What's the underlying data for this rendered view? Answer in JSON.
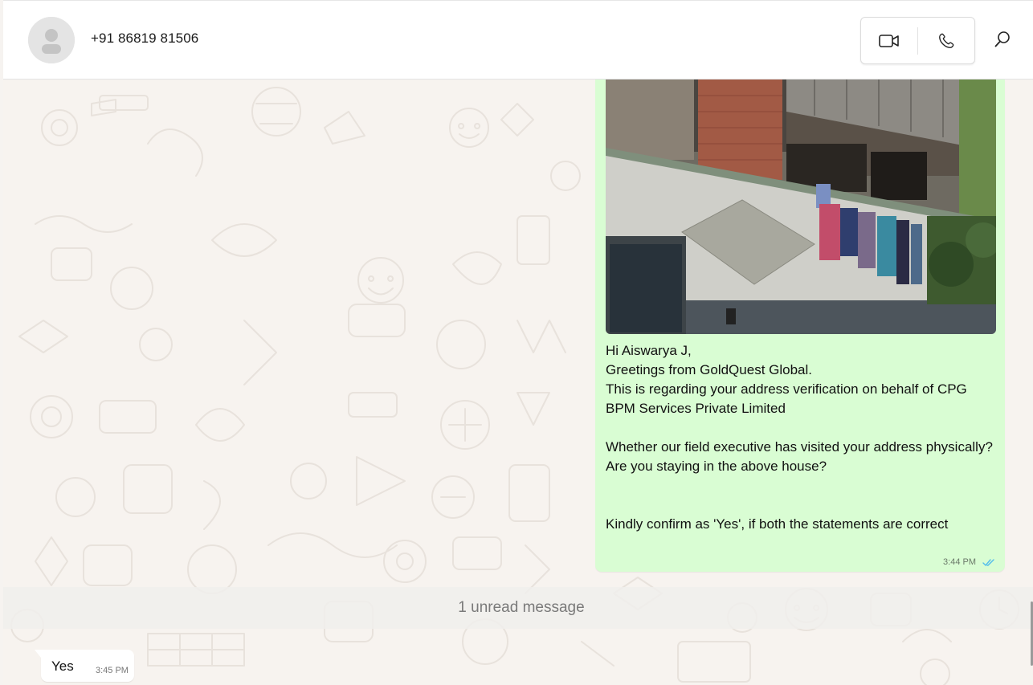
{
  "header": {
    "contact_name": "+91 86819 81506",
    "video_call_icon": "video-camera-icon",
    "voice_call_icon": "phone-icon",
    "search_icon": "search-icon"
  },
  "messages": {
    "outgoing": {
      "image": "photo-of-building-with-clothes-on-balcony",
      "lines": [
        "Hi Aiswarya J,",
        "Greetings from GoldQuest Global.",
        "This is regarding your address verification on behalf of CPG BPM Services Private Limited",
        "",
        "Whether our field executive has visited your address physically?",
        "Are you staying in the above house?",
        "",
        "",
        "Kindly confirm as 'Yes', if both the statements are correct"
      ],
      "time": "3:44 PM",
      "status_icon": "double-check-icon",
      "status_color": "#53bdeb",
      "bubble_color": "#d9fdd3"
    },
    "unread_divider": "1 unread message",
    "incoming": {
      "text": "Yes",
      "time": "3:45 PM"
    }
  }
}
